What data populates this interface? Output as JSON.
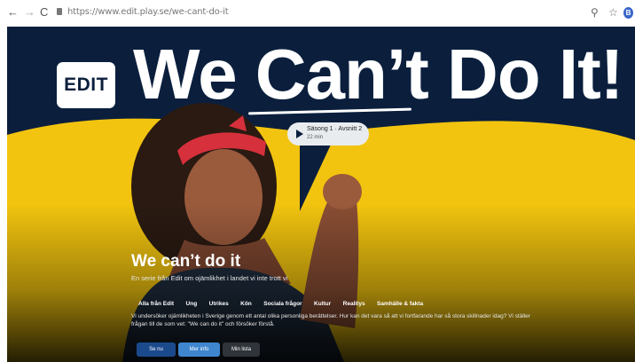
{
  "browser": {
    "nav_back": "←",
    "nav_forward": "→",
    "nav_reload": "C",
    "url": "https://www.edit.play.se/we-cant-do-it",
    "zoom_icon": "⚲",
    "star_icon": "☆",
    "profile_initial": "B"
  },
  "hero": {
    "logo_text": "EDIT",
    "headline": "We Can’t Do It!",
    "season_pill": {
      "label": "Säsong 1 · Avsnitt 2",
      "duration": "22 min"
    },
    "title": "We can’t do it",
    "subtitle": "En serie från Edit om ojämlikhet i landet vi inte trott vi",
    "tags": [
      "Alla från Edit",
      "Ung",
      "Utrikes",
      "Kön",
      "Sociala frågor",
      "Kultur",
      "Realitys",
      "Samhälle & fakta"
    ],
    "description": "Vi undersöker ojämlikheten i Sverige genom ett antal olika personliga berättelser. Hur kan det vara så att vi fortfarande har så stora skillnader idag? Vi ställer frågan till de som vet: \"We can do it\" och försöker förstå.",
    "buttons": {
      "primary": "Se nu",
      "secondary": "Mer info",
      "tertiary": "Min lista"
    }
  },
  "colors": {
    "navy": "#0b1f3d",
    "yellow": "#f2c40f",
    "pill": "#e9ecef",
    "headband": "#d5303b"
  }
}
